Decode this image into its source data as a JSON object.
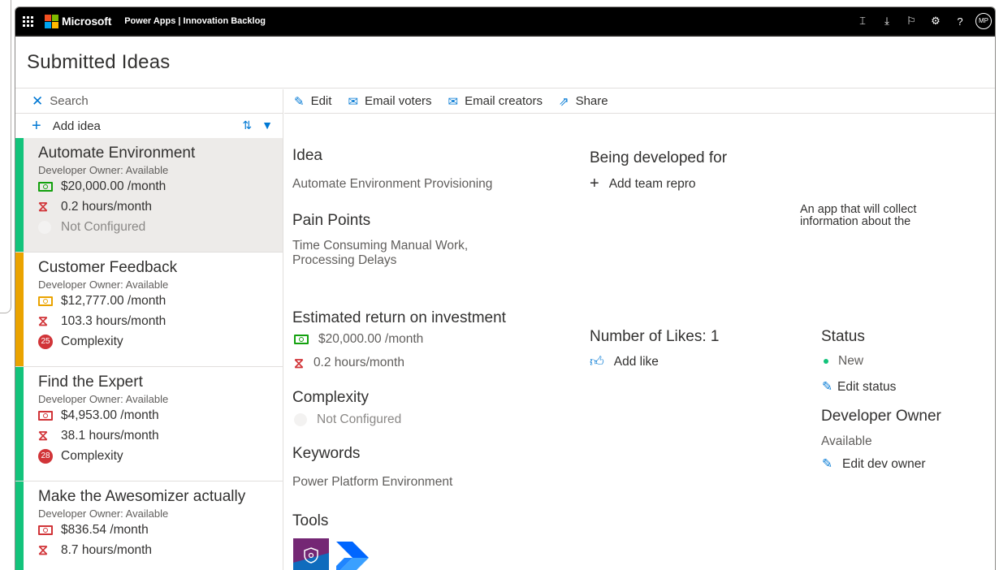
{
  "topbar": {
    "brand": "Microsoft",
    "app_title": "Power Apps | Innovation Backlog",
    "avatar_initials": "MP",
    "icons": [
      "fit-icon",
      "download-icon",
      "flag-icon",
      "settings-icon",
      "help-icon"
    ]
  },
  "page_title": "Submitted Ideas",
  "left": {
    "search_placeholder": "Search",
    "add_label": "Add idea",
    "ideas": [
      {
        "title": "Automate Environment",
        "owner": "Developer Owner: Available",
        "money": "$20,000.00 /month",
        "hours": "0.2 hours/month",
        "complexity": "Not Configured",
        "complexity_badge": "",
        "stripe": "#13c37b",
        "money_color": "#13a10e",
        "selected": true
      },
      {
        "title": "Customer Feedback",
        "owner": "Developer Owner: Available",
        "money": "$12,777.00 /month",
        "hours": "103.3 hours/month",
        "complexity": "Complexity",
        "complexity_badge": "25",
        "stripe": "#eaa300",
        "money_color": "#eaa300",
        "selected": false
      },
      {
        "title": "Find the Expert",
        "owner": "Developer Owner: Available",
        "money": "$4,953.00 /month",
        "hours": "38.1 hours/month",
        "complexity": "Complexity",
        "complexity_badge": "28",
        "stripe": "#13c37b",
        "money_color": "#d13438",
        "selected": false
      },
      {
        "title": "Make the Awesomizer actually",
        "owner": "Developer Owner: Available",
        "money": "$836.54 /month",
        "hours": "8.7 hours/month",
        "complexity": "",
        "complexity_badge": "",
        "stripe": "#13c37b",
        "money_color": "#d13438",
        "selected": false
      }
    ]
  },
  "commands": {
    "edit": "Edit",
    "email_voters": "Email voters",
    "email_creators": "Email creators",
    "share": "Share"
  },
  "detail": {
    "idea_heading": "Idea",
    "idea_value": "Automate Environment Provisioning",
    "pain_heading": "Pain Points",
    "pain_line1": "Time Consuming Manual Work,",
    "pain_line2": "Processing Delays",
    "roi_heading": "Estimated return on investment",
    "roi_money": "$20,000.00 /month",
    "roi_hours": "0.2 hours/month",
    "complexity_heading": "Complexity",
    "complexity_value": "Not Configured",
    "keywords_heading": "Keywords",
    "keywords_value": "Power Platform Environment",
    "tools_heading": "Tools",
    "being_developed_heading": "Being developed for",
    "add_team_repro": "Add team repro",
    "description_line1": "An app that will collect",
    "description_line2": "information about the",
    "likes_heading": "Number of Likes: 1",
    "add_like": "Add like",
    "status_heading": "Status",
    "status_value": "New",
    "edit_status": "Edit status",
    "dev_owner_heading": "Developer Owner",
    "dev_owner_value": "Available",
    "edit_dev_owner": "Edit dev owner"
  },
  "colors": {
    "accent": "#0078d4",
    "green": "#13c37b",
    "amber": "#eaa300",
    "red": "#d13438"
  }
}
